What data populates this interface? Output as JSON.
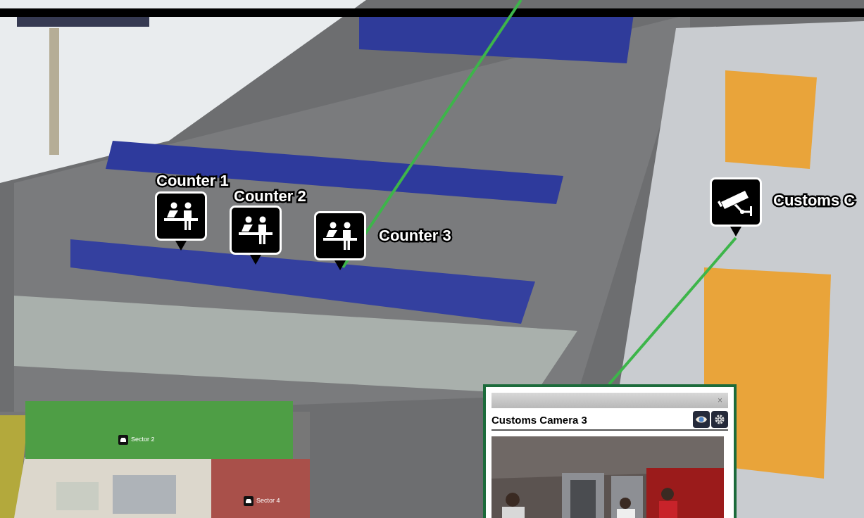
{
  "markers": [
    {
      "kind": "counter",
      "label": "Counter 1"
    },
    {
      "kind": "counter",
      "label": "Counter 2"
    },
    {
      "kind": "counter",
      "label": "Counter 3"
    },
    {
      "kind": "camera",
      "label": "Customs C"
    }
  ],
  "camera_popup": {
    "close": "×",
    "title": "Customs Camera 3"
  },
  "minimap": {
    "sectors": [
      {
        "label": "Sector 2",
        "color": "#4e9e45"
      },
      {
        "label": "Sector 4",
        "color": "#a9504a"
      }
    ]
  }
}
